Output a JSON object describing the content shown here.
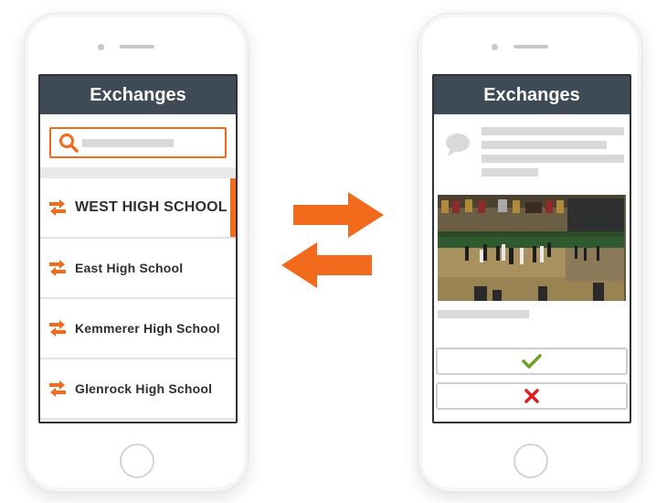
{
  "left_screen": {
    "title": "Exchanges",
    "schools": [
      {
        "label": "WEST HIGH SCHOOL",
        "selected": true
      },
      {
        "label": "East High School",
        "selected": false
      },
      {
        "label": "Kemmerer High School",
        "selected": false
      },
      {
        "label": "Glenrock High School",
        "selected": false
      }
    ],
    "icons": {
      "search": "search-icon",
      "swap": "swap-arrows-icon"
    }
  },
  "right_screen": {
    "title": "Exchanges",
    "icons": {
      "comment": "speech-bubble-icon",
      "approve": "checkmark-icon",
      "reject": "x-icon"
    }
  },
  "center": {
    "icon": "exchange-arrows-icon"
  },
  "colors": {
    "accent": "#f26b1d",
    "header_bg": "#3e4a55",
    "approve": "#6aa31f",
    "reject": "#e02020",
    "placeholder": "#d9d9d9"
  }
}
